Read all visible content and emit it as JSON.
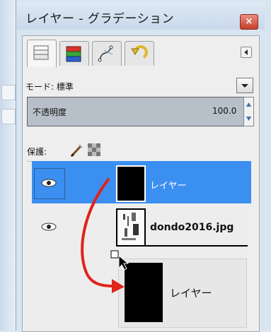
{
  "window": {
    "title": "レイヤー - グラデーション",
    "close_glyph": "×"
  },
  "tabs": [
    {
      "icon": "layers-stack-icon"
    },
    {
      "icon": "color-channels-icon"
    },
    {
      "icon": "paths-icon"
    },
    {
      "icon": "undo-history-icon"
    }
  ],
  "mode": {
    "label": "モード: 標準"
  },
  "opacity": {
    "label": "不透明度",
    "value": "100.0"
  },
  "lock": {
    "label": "保護:"
  },
  "layers": [
    {
      "name": "レイヤー",
      "selected": true
    },
    {
      "name": "dondo2016.jpg",
      "selected": false
    }
  ],
  "drag_preview": {
    "name": "レイヤー"
  },
  "colors": {
    "selection": "#3b8ff0",
    "arrow": "#e0231b"
  }
}
